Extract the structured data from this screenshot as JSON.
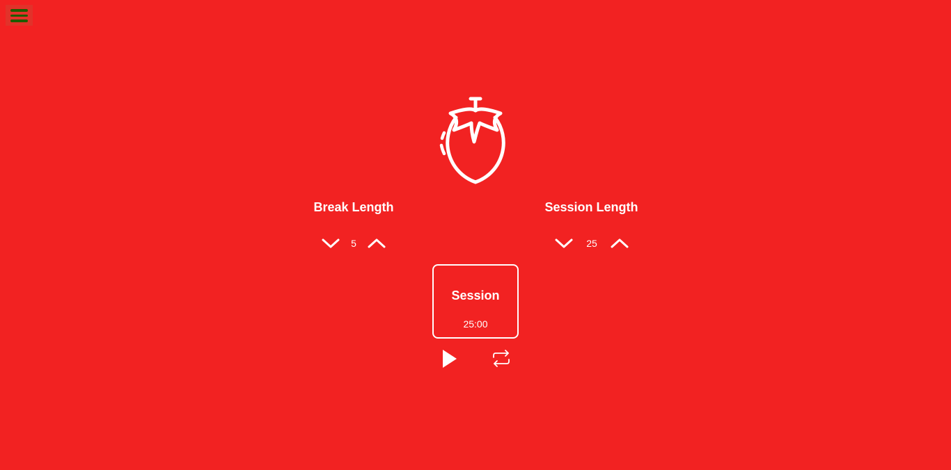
{
  "page": {
    "background_color": "#f22222",
    "menu_icon_color": "#1f5b00"
  },
  "menu": {
    "icon": "hamburger-menu-icon"
  },
  "logo": {
    "icon": "tomato-icon"
  },
  "break": {
    "title": "Break Length",
    "value": "5",
    "decrement_icon": "chevron-down-icon",
    "increment_icon": "chevron-up-icon"
  },
  "session": {
    "title": "Session Length",
    "value": "25",
    "decrement_icon": "chevron-down-icon",
    "increment_icon": "chevron-up-icon"
  },
  "timer": {
    "label": "Session",
    "time": "25:00"
  },
  "controls": {
    "play_icon": "play-icon",
    "reset_icon": "repeat-icon"
  }
}
